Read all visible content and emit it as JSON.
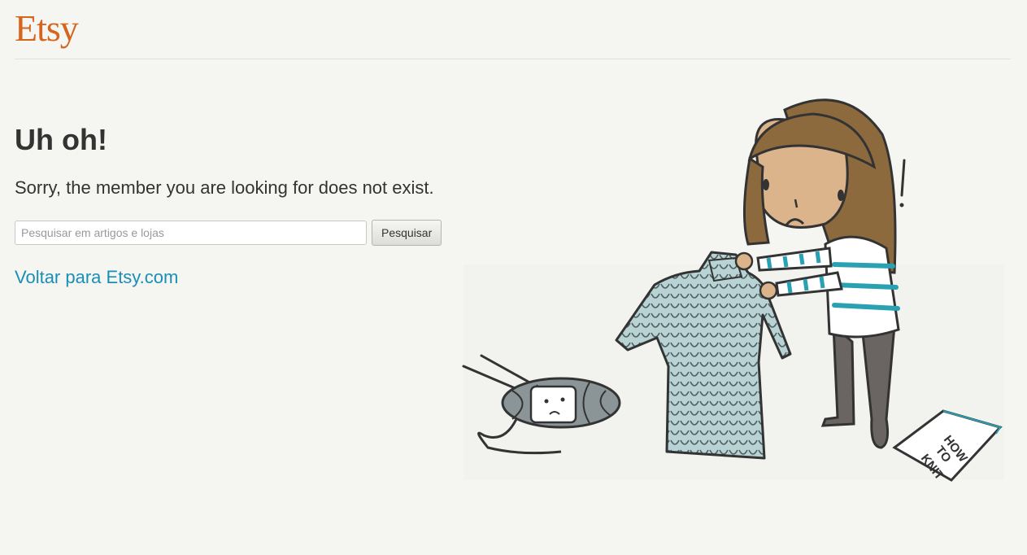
{
  "header": {
    "logo_text": "Etsy"
  },
  "main": {
    "heading": "Uh oh!",
    "message": "Sorry, the member you are looking for does not exist.",
    "search": {
      "placeholder": "Pesquisar em artigos e lojas",
      "value": "",
      "button_label": "Pesquisar"
    },
    "back_link": "Voltar para Etsy.com"
  },
  "illustration": {
    "book_text": [
      "HOW",
      "TO",
      "KNIT"
    ],
    "exclamation": "!"
  },
  "colors": {
    "brand": "#d5641c",
    "link": "#1a8fb5",
    "background": "#f5f5f1"
  }
}
